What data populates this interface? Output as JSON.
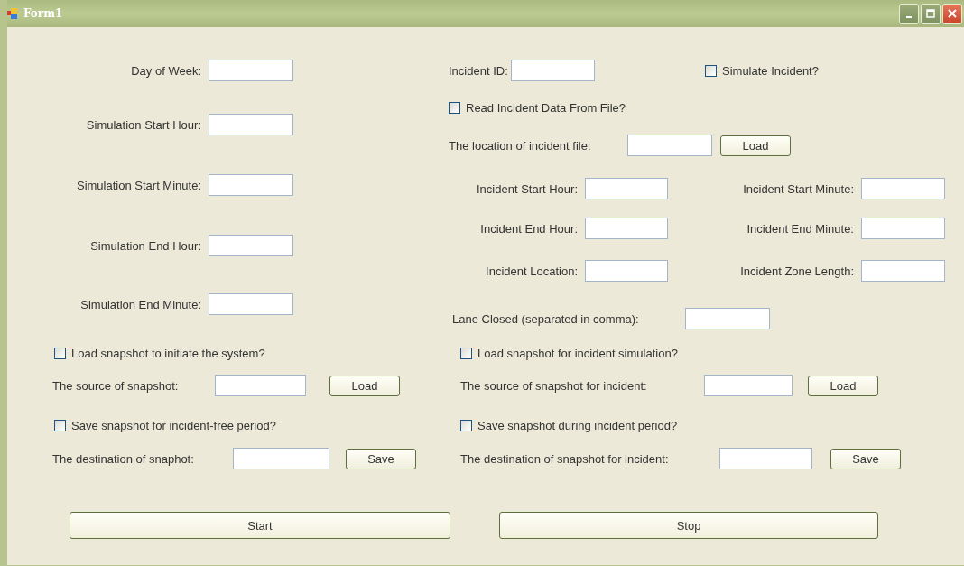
{
  "window": {
    "title": "Form1"
  },
  "left": [
    {
      "kind": "field",
      "label": "Day of Week:"
    },
    {
      "kind": "field",
      "label": "Simulation Start Hour:"
    },
    {
      "kind": "field",
      "label": "Simulation Start Minute:"
    },
    {
      "kind": "field",
      "label": "Simulation End Hour:"
    },
    {
      "kind": "field",
      "label": "Simulation End Minute:"
    },
    {
      "kind": "checkbox",
      "label": "Load snapshot to initiate the system?",
      "checked": false
    },
    {
      "kind": "field_button",
      "label": "The source of snapshot:",
      "button": "Load"
    },
    {
      "kind": "checkbox",
      "label": "Save snapshot for incident-free period?",
      "checked": false
    },
    {
      "kind": "field_button",
      "label": "The destination of snaphot:",
      "button": "Save"
    }
  ],
  "right": [
    {
      "kind": "field_check",
      "label": "Incident ID:",
      "checkbox": {
        "label": "Simulate Incident?",
        "checked": false
      }
    },
    {
      "kind": "checkbox",
      "label": "Read Incident Data From File?",
      "checked": false
    },
    {
      "kind": "field_button",
      "label": "The location of incident file:",
      "button": "Load"
    },
    {
      "kind": "pair",
      "items": [
        {
          "label": "Incident Start Hour:"
        },
        {
          "label": "Incident Start Minute:"
        }
      ]
    },
    {
      "kind": "pair",
      "items": [
        {
          "label": "Incident End Hour:"
        },
        {
          "label": "Incident End Minute:"
        }
      ]
    },
    {
      "kind": "pair",
      "items": [
        {
          "label": "Incident Location:"
        },
        {
          "label": "Incident Zone Length:"
        }
      ]
    },
    {
      "kind": "field",
      "label": "Lane Closed (separated in comma):"
    },
    {
      "kind": "checkbox",
      "label": "Load snapshot for incident simulation?",
      "checked": false
    },
    {
      "kind": "field_button",
      "label": "The source of snapshot for incident:",
      "button": "Load"
    },
    {
      "kind": "checkbox",
      "label": "Save snapshot during incident period?",
      "checked": false
    },
    {
      "kind": "field_button",
      "label": "The destination of snapshot for incident:",
      "button": "Save"
    }
  ],
  "buttons": [
    {
      "label": "Start"
    },
    {
      "label": "Stop"
    }
  ]
}
